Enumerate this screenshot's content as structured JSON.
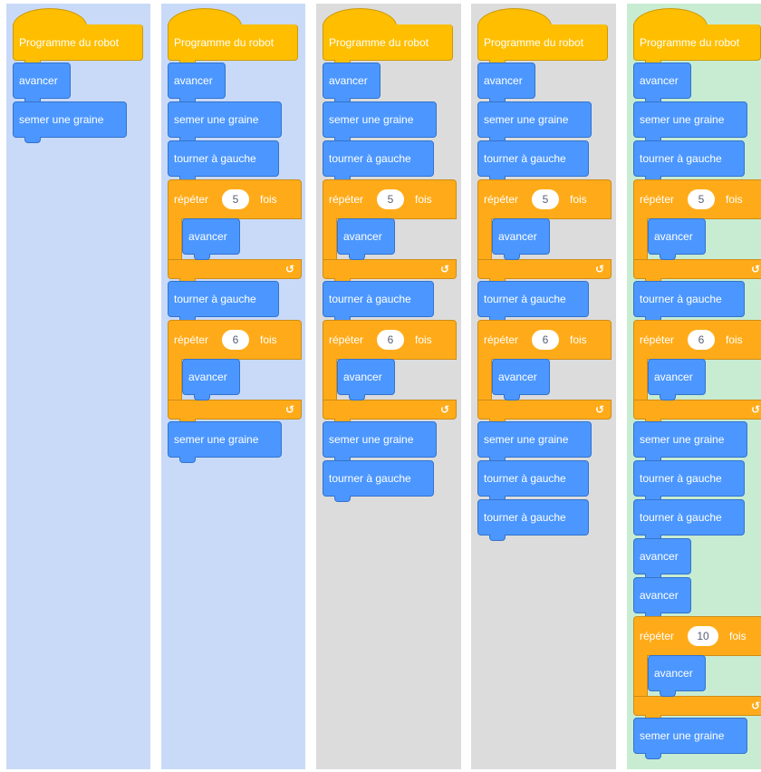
{
  "palette": {
    "panel_blue": "#c9daf8",
    "panel_gray": "#dcdcdc",
    "panel_green": "#c8ecd2",
    "motion_blue": "#4c97ff",
    "control_orange": "#ffab19",
    "events_yellow": "#ffbf00"
  },
  "programs": [
    {
      "bg": "panel_blue",
      "blocks": [
        {
          "type": "hat",
          "label": "Programme du robot"
        },
        {
          "type": "cmd",
          "label": "avancer"
        },
        {
          "type": "cmd",
          "label": "semer une graine"
        }
      ]
    },
    {
      "bg": "panel_blue",
      "blocks": [
        {
          "type": "hat",
          "label": "Programme du robot"
        },
        {
          "type": "cmd",
          "label": "avancer"
        },
        {
          "type": "cmd",
          "label": "semer une graine"
        },
        {
          "type": "cmd",
          "label": "tourner à gauche"
        },
        {
          "type": "repeat",
          "prefix": "répéter",
          "count": "5",
          "suffix": "fois",
          "body": [
            {
              "type": "cmd",
              "label": "avancer"
            }
          ],
          "arrow": "↺"
        },
        {
          "type": "cmd",
          "label": "tourner à gauche"
        },
        {
          "type": "repeat",
          "prefix": "répéter",
          "count": "6",
          "suffix": "fois",
          "body": [
            {
              "type": "cmd",
              "label": "avancer"
            }
          ],
          "arrow": "↺"
        },
        {
          "type": "cmd",
          "label": "semer une graine"
        }
      ]
    },
    {
      "bg": "panel_gray",
      "blocks": [
        {
          "type": "hat",
          "label": "Programme du robot"
        },
        {
          "type": "cmd",
          "label": "avancer"
        },
        {
          "type": "cmd",
          "label": "semer une graine"
        },
        {
          "type": "cmd",
          "label": "tourner à gauche"
        },
        {
          "type": "repeat",
          "prefix": "répéter",
          "count": "5",
          "suffix": "fois",
          "body": [
            {
              "type": "cmd",
              "label": "avancer"
            }
          ],
          "arrow": "↺"
        },
        {
          "type": "cmd",
          "label": "tourner à gauche"
        },
        {
          "type": "repeat",
          "prefix": "répéter",
          "count": "6",
          "suffix": "fois",
          "body": [
            {
              "type": "cmd",
              "label": "avancer"
            }
          ],
          "arrow": "↺"
        },
        {
          "type": "cmd",
          "label": "semer une graine"
        },
        {
          "type": "cmd",
          "label": "tourner à gauche"
        }
      ]
    },
    {
      "bg": "panel_gray",
      "blocks": [
        {
          "type": "hat",
          "label": "Programme du robot"
        },
        {
          "type": "cmd",
          "label": "avancer"
        },
        {
          "type": "cmd",
          "label": "semer une graine"
        },
        {
          "type": "cmd",
          "label": "tourner à gauche"
        },
        {
          "type": "repeat",
          "prefix": "répéter",
          "count": "5",
          "suffix": "fois",
          "body": [
            {
              "type": "cmd",
              "label": "avancer"
            }
          ],
          "arrow": "↺"
        },
        {
          "type": "cmd",
          "label": "tourner à gauche"
        },
        {
          "type": "repeat",
          "prefix": "répéter",
          "count": "6",
          "suffix": "fois",
          "body": [
            {
              "type": "cmd",
              "label": "avancer"
            }
          ],
          "arrow": "↺"
        },
        {
          "type": "cmd",
          "label": "semer une graine"
        },
        {
          "type": "cmd",
          "label": "tourner à gauche"
        },
        {
          "type": "cmd",
          "label": "tourner à gauche"
        }
      ]
    },
    {
      "bg": "panel_green",
      "blocks": [
        {
          "type": "hat",
          "label": "Programme du robot"
        },
        {
          "type": "cmd",
          "label": "avancer"
        },
        {
          "type": "cmd",
          "label": "semer une graine"
        },
        {
          "type": "cmd",
          "label": "tourner à gauche"
        },
        {
          "type": "repeat",
          "prefix": "répéter",
          "count": "5",
          "suffix": "fois",
          "body": [
            {
              "type": "cmd",
              "label": "avancer"
            }
          ],
          "arrow": "↺"
        },
        {
          "type": "cmd",
          "label": "tourner à gauche"
        },
        {
          "type": "repeat",
          "prefix": "répéter",
          "count": "6",
          "suffix": "fois",
          "body": [
            {
              "type": "cmd",
              "label": "avancer"
            }
          ],
          "arrow": "↺"
        },
        {
          "type": "cmd",
          "label": "semer une graine"
        },
        {
          "type": "cmd",
          "label": "tourner à gauche"
        },
        {
          "type": "cmd",
          "label": "tourner à gauche"
        },
        {
          "type": "cmd",
          "label": "avancer"
        },
        {
          "type": "cmd",
          "label": "avancer"
        },
        {
          "type": "repeat",
          "prefix": "répéter",
          "count": "10",
          "suffix": "fois",
          "body": [
            {
              "type": "cmd",
              "label": "avancer"
            }
          ],
          "arrow": "↺"
        },
        {
          "type": "cmd",
          "label": "semer une graine"
        }
      ]
    }
  ]
}
